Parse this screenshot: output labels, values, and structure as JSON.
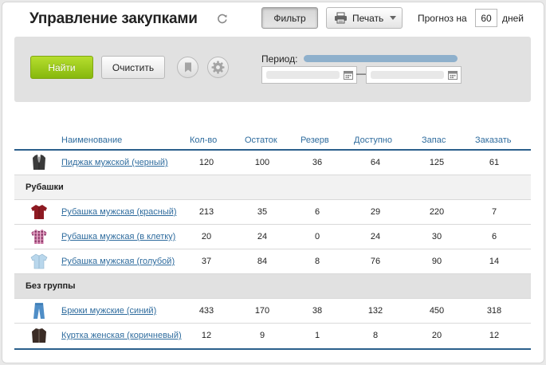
{
  "header": {
    "title": "Управление закупками",
    "filter_label": "Фильтр",
    "print_label": "Печать",
    "forecast_label": "Прогноз на",
    "forecast_value": "60",
    "forecast_unit": "дней"
  },
  "filter_panel": {
    "find_label": "Найти",
    "clear_label": "Очистить",
    "period_label": "Период:",
    "date_separator": "—"
  },
  "table": {
    "columns": [
      "Наименование",
      "Кол-во",
      "Остаток",
      "Резерв",
      "Доступно",
      "Запас",
      "Заказать"
    ],
    "item_top": {
      "name": "Пиджак мужской (черный)",
      "thumb": "jacket-black-icon",
      "values": [
        "120",
        "100",
        "36",
        "64",
        "125",
        "61"
      ]
    },
    "group_shirts": {
      "label": "Рубашки",
      "items": [
        {
          "name": "Рубашка мужская (красный)",
          "thumb": "shirt-red-icon",
          "values": [
            "213",
            "35",
            "6",
            "29",
            "220",
            "7"
          ]
        },
        {
          "name": "Рубашка мужская (в клетку)",
          "thumb": "shirt-plaid-icon",
          "values": [
            "20",
            "24",
            "0",
            "24",
            "30",
            "6"
          ]
        },
        {
          "name": "Рубашка мужская (голубой)",
          "thumb": "shirt-blue-icon",
          "values": [
            "37",
            "84",
            "8",
            "76",
            "90",
            "14"
          ]
        }
      ]
    },
    "group_none": {
      "label": "Без группы",
      "items": [
        {
          "name": "Брюки мужские (синий)",
          "thumb": "jeans-blue-icon",
          "values": [
            "433",
            "170",
            "38",
            "132",
            "450",
            "318"
          ]
        },
        {
          "name": "Куртка женская (коричневый)",
          "thumb": "jacket-brown-icon",
          "values": [
            "12",
            "9",
            "1",
            "8",
            "20",
            "12"
          ]
        }
      ]
    }
  },
  "colors": {
    "accent": "#2f6c9e",
    "find_button": "#9ccb1d",
    "period_bar": "#8eb0cc",
    "panel_bg": "#e1e1e1"
  }
}
